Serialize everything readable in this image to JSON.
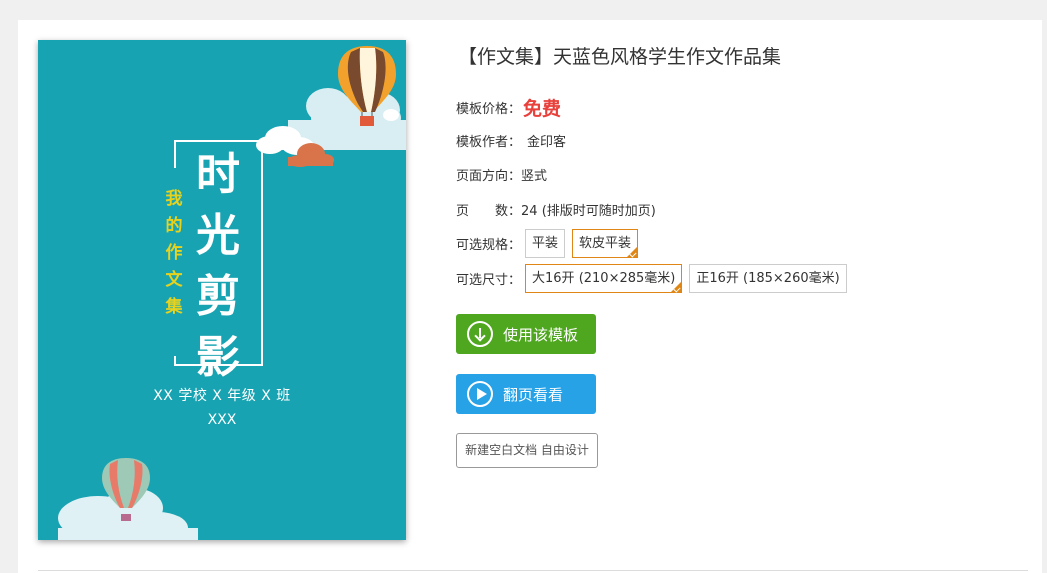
{
  "cover": {
    "title_chars": [
      "时",
      "光",
      "剪",
      "影"
    ],
    "subtitle_chars": [
      "我",
      "的",
      "作",
      "文",
      "集"
    ],
    "school_line": "XX 学校 X 年级 X 班",
    "author_line": "XXX"
  },
  "product": {
    "title": "【作文集】天蓝色风格学生作文作品集",
    "price_label": "模板价格：",
    "price_value": "免费",
    "author_label": "模板作者：",
    "author_value": "金印客",
    "orientation_label": "页面方向：",
    "orientation_value": "竖式",
    "pages_label": "页　　数：",
    "pages_value": "24 (排版时可随时加页)",
    "spec_label": "可选规格：",
    "spec_options": [
      "平装",
      "软皮平装"
    ],
    "spec_selected_index": 1,
    "size_label": "可选尺寸：",
    "size_options": [
      "大16开 (210×285毫米)",
      "正16开 (185×260毫米)"
    ],
    "size_selected_index": 0
  },
  "actions": {
    "use_template": "使用该模板",
    "flip_view": "翻页看看",
    "new_blank": "新建空白文档 自由设计"
  },
  "colors": {
    "cover_bg": "#18a3b2",
    "price": "#e8403b",
    "use_btn": "#4fa61f",
    "flip_btn": "#27a2e6",
    "selected_border": "#e08617",
    "subtitle": "#e7d21d"
  },
  "icons": {
    "use_template": "download-arrow-icon",
    "flip_view": "play-icon"
  }
}
